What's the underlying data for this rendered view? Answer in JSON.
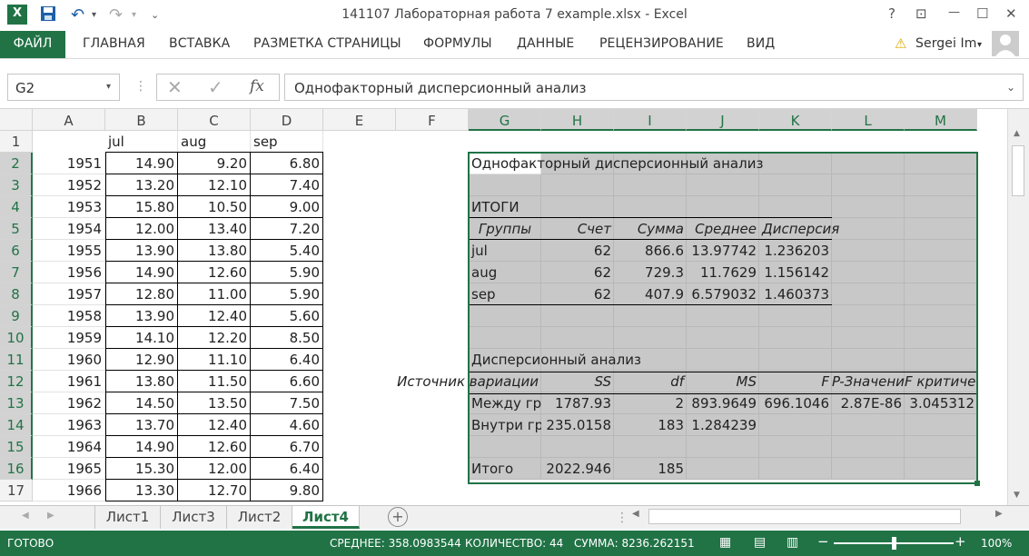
{
  "window": {
    "title": "141107 Лабораторная работа 7 example.xlsx - Excel",
    "help": "?",
    "min": "—",
    "max": "☐",
    "close": "✕"
  },
  "ribbon": {
    "file": "ФАЙЛ",
    "tabs": [
      "ГЛАВНАЯ",
      "ВСТАВКА",
      "РАЗМЕТКА СТРАНИЦЫ",
      "ФОРМУЛЫ",
      "ДАННЫЕ",
      "РЕЦЕНЗИРОВАНИЕ",
      "ВИД"
    ],
    "user": "Sergei Im"
  },
  "formula_bar": {
    "name_box": "G2",
    "fx": "fx",
    "content": "Однофакторный дисперсионный анализ"
  },
  "columns": [
    "A",
    "B",
    "C",
    "D",
    "E",
    "F",
    "G",
    "H",
    "I",
    "J",
    "K",
    "L",
    "M"
  ],
  "rows": [
    "1",
    "2",
    "3",
    "4",
    "5",
    "6",
    "7",
    "8",
    "9",
    "10",
    "11",
    "12",
    "13",
    "14",
    "15",
    "16",
    "17"
  ],
  "data_headers": [
    "jul",
    "aug",
    "sep"
  ],
  "data_rows": [
    [
      "1951",
      "14.90",
      "9.20",
      "6.80"
    ],
    [
      "1952",
      "13.20",
      "12.10",
      "7.40"
    ],
    [
      "1953",
      "15.80",
      "10.50",
      "9.00"
    ],
    [
      "1954",
      "12.00",
      "13.40",
      "7.20"
    ],
    [
      "1955",
      "13.90",
      "13.80",
      "5.40"
    ],
    [
      "1956",
      "14.90",
      "12.60",
      "5.90"
    ],
    [
      "1957",
      "12.80",
      "11.00",
      "5.90"
    ],
    [
      "1958",
      "13.90",
      "12.40",
      "5.60"
    ],
    [
      "1959",
      "14.10",
      "12.20",
      "8.50"
    ],
    [
      "1960",
      "12.90",
      "11.10",
      "6.40"
    ],
    [
      "1961",
      "13.80",
      "11.50",
      "6.60"
    ],
    [
      "1962",
      "14.50",
      "13.50",
      "7.50"
    ],
    [
      "1963",
      "13.70",
      "12.40",
      "4.60"
    ],
    [
      "1964",
      "14.90",
      "12.60",
      "6.70"
    ],
    [
      "1965",
      "15.30",
      "12.00",
      "6.40"
    ],
    [
      "1966",
      "13.30",
      "12.70",
      "9.80"
    ]
  ],
  "anova": {
    "title": "Однофакторный дисперсионный анализ",
    "itogi": "ИТОГИ",
    "summary_headers": [
      "Группы",
      "Счет",
      "Сумма",
      "Среднее",
      "Дисперсия"
    ],
    "summary_rows": [
      [
        "jul",
        "62",
        "866.6",
        "13.97742",
        "1.236203"
      ],
      [
        "aug",
        "62",
        "729.3",
        "11.7629",
        "1.156142"
      ],
      [
        "sep",
        "62",
        "407.9",
        "6.579032",
        "1.460373"
      ]
    ],
    "anova_title": "Дисперсионный анализ",
    "anova_headers": [
      "Источник вариации",
      "SS",
      "df",
      "MS",
      "F",
      "P-Значение",
      "F критическое"
    ],
    "anova_rows": [
      [
        "Между группами",
        "1787.93",
        "2",
        "893.9649",
        "696.1046",
        "2.87E-86",
        "3.045312"
      ],
      [
        "Внутри групп",
        "235.0158",
        "183",
        "1.284239",
        "",
        "",
        ""
      ]
    ],
    "total": [
      "Итого",
      "2022.946",
      "185"
    ]
  },
  "sheets": [
    "Лист1",
    "Лист3",
    "Лист2",
    "Лист4"
  ],
  "active_sheet": "Лист4",
  "status": {
    "ready": "ГОТОВО",
    "avg": "СРЕДНЕЕ: 358.0983544",
    "count": "КОЛИЧЕСТВО: 44",
    "sum": "СУММА: 8236.262151",
    "zoom": "100%"
  },
  "colors": {
    "accent": "#217346",
    "selection": "#c8c8c8"
  }
}
